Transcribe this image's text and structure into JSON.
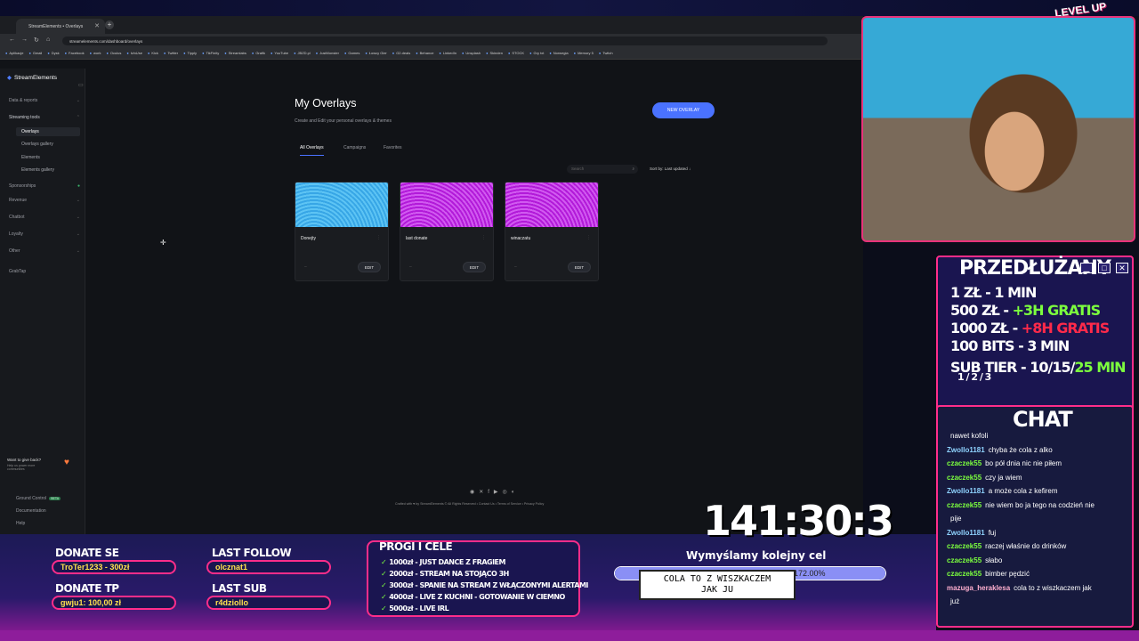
{
  "browser": {
    "tab_title": "StreamElements • Overlays",
    "new_tab": "+",
    "url": "streamelements.com/dashboard/overlays",
    "bookmarks": [
      "Aplikacje",
      "Gmail",
      "Dysk",
      "Facebook",
      "work",
      "Oculus",
      "lvlnUse",
      "Kick",
      "Twitter",
      "Tipply",
      "TikFinity",
      "Streamlabs",
      "Grafik",
      "YouTube",
      "JBZD.pl",
      "JustMonster",
      "Games",
      "Łowcy Gier",
      "G2.deals",
      "Behance",
      "LinkedIn",
      "Unsplash",
      "Skinden",
      "STOCK",
      "Gry txt",
      "Norwegia",
      "Memory 5",
      "Twitch"
    ]
  },
  "sidebar": {
    "logo": "StreamElements",
    "items": [
      {
        "label": "Data & reports"
      },
      {
        "label": "Streaming tools"
      },
      {
        "label": "Sponsorships"
      },
      {
        "label": "Revenue"
      },
      {
        "label": "Chatbot"
      },
      {
        "label": "Loyalty"
      },
      {
        "label": "Other"
      },
      {
        "label": "GrabTap"
      }
    ],
    "subitems": [
      "Overlays",
      "Overlays gallery",
      "Elements",
      "Elements gallery"
    ],
    "give_title": "Want to give back?",
    "give_sub": "Help us power more communities",
    "bottom": [
      "Ground Control",
      "Documentation",
      "Help"
    ],
    "beta": "BETA"
  },
  "main": {
    "title": "My Overlays",
    "subtitle": "Create and Edit your personal overlays & themes",
    "new_button": "NEW OVERLAY",
    "tabs": [
      "All Overlays",
      "Campaigns",
      "Favorites"
    ],
    "search_placeholder": "Search",
    "sort_label": "Sort by: Last updated",
    "cards": [
      {
        "name": "Donejty",
        "edit": "EDIT"
      },
      {
        "name": "last donate",
        "edit": "EDIT"
      },
      {
        "name": "winaczatu",
        "edit": "EDIT"
      }
    ],
    "footer": "Crafted with ♥ by StreamElements © All Rights Reserved • Contact Us • Terms of Service • Privacy Policy"
  },
  "stream": {
    "levelup": "LEVEL UP",
    "przedluzany": {
      "title": "PRZEDŁUŻANY",
      "rows": [
        {
          "left": "1 ZŁ",
          "right": "- 1 MIN",
          "extra": ""
        },
        {
          "left": "500 ZŁ",
          "right": "- ",
          "extra": "+3H GRATIS"
        },
        {
          "left": "1000 ZŁ",
          "right": "- ",
          "extra": "+8H GRATIS"
        },
        {
          "left": "100 BITS",
          "right": "- 3 MIN",
          "extra": ""
        },
        {
          "left": "SUB TIER",
          "right": "- 10/15/",
          "extra": "25 MIN"
        },
        {
          "left": "1 / 2 / 3",
          "right": "",
          "extra": ""
        }
      ]
    },
    "chat": {
      "title": "CHAT",
      "messages": [
        {
          "user": "",
          "text": "nawet kofoli"
        },
        {
          "user": "Zwollo1181",
          "text": "chyba że cola z alko"
        },
        {
          "user": "czaczek55",
          "text": "bo pół dnia nic nie piłem"
        },
        {
          "user": "czaczek55",
          "text": "czy ja wiem"
        },
        {
          "user": "Zwollo1181",
          "text": "a może cola z kefirem"
        },
        {
          "user": "czaczek55",
          "text": "nie wiem bo ja tego na codzień nie"
        },
        {
          "user": "",
          "text": "pije"
        },
        {
          "user": "Zwollo1181",
          "text": "fuj"
        },
        {
          "user": "czaczek55",
          "text": "raczej właśnie do drinków"
        },
        {
          "user": "czaczek55",
          "text": "słabo"
        },
        {
          "user": "czaczek55",
          "text": "bimber pędzić"
        },
        {
          "user": "mazuga_heraklesa",
          "text": "cola to z wiszkaczem jak"
        },
        {
          "user": "",
          "text": "już"
        }
      ]
    },
    "timer": "141:30:3",
    "donate_se": {
      "title": "DONATE SE",
      "value": "TroTer1233 - 300zł"
    },
    "donate_tp": {
      "title": "DONATE TP",
      "value": "gwju1: 100,00 zł"
    },
    "last_follow": {
      "title": "LAST FOLLOW",
      "value": "olcznat1"
    },
    "last_sub": {
      "title": "LAST SUB",
      "value": "r4dziollo"
    },
    "progi": {
      "title": "PROGI I CELE",
      "lines": [
        "1000zł - JUST DANCE Z FRAGIEM",
        "2000zł - STREAM NA STOJĄCO 3H",
        "3000zł - SPANIE NA STREAM Z WŁĄCZONYMI ALERTAMI",
        "4000zł - LIVE Z KUCHNI - GOTOWANIE W CIEMNO",
        "5000zł - LIVE IRL"
      ]
    },
    "goal": {
      "title": "Wymyślamy kolejny cel",
      "pct": "172.00%",
      "progress": 1.0,
      "bubble_line1": "COLA TO Z WISZKACZEM",
      "bubble_line2": "JAK JU"
    }
  }
}
